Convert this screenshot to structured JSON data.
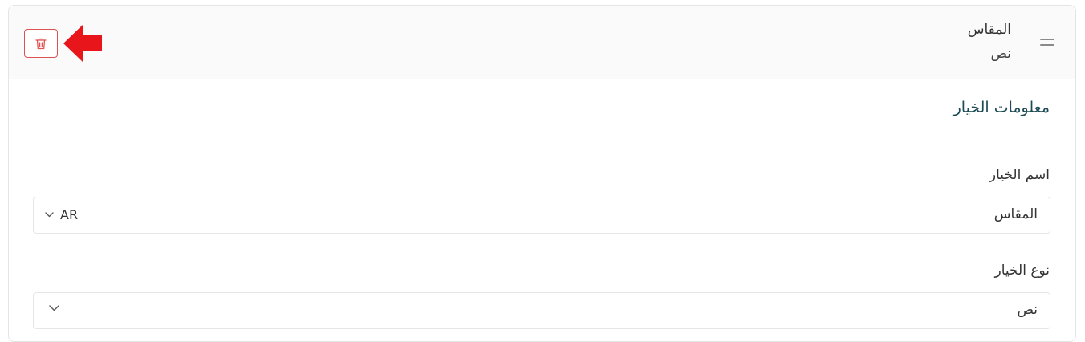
{
  "option_card": {
    "header": {
      "title": "المقاس",
      "subtitle": "نص",
      "drag_icon": "hamburger-menu-icon",
      "delete_icon": "trash-icon"
    },
    "section_title": "معلومات الخيار",
    "option_name": {
      "label": "اسم الخيار",
      "value": "المقاس",
      "language": "AR"
    },
    "option_type": {
      "label": "نوع الخيار",
      "value": "نص"
    }
  },
  "colors": {
    "danger": "#e05252",
    "annotation_arrow": "#e8161b",
    "section_title": "#1d4b55"
  }
}
